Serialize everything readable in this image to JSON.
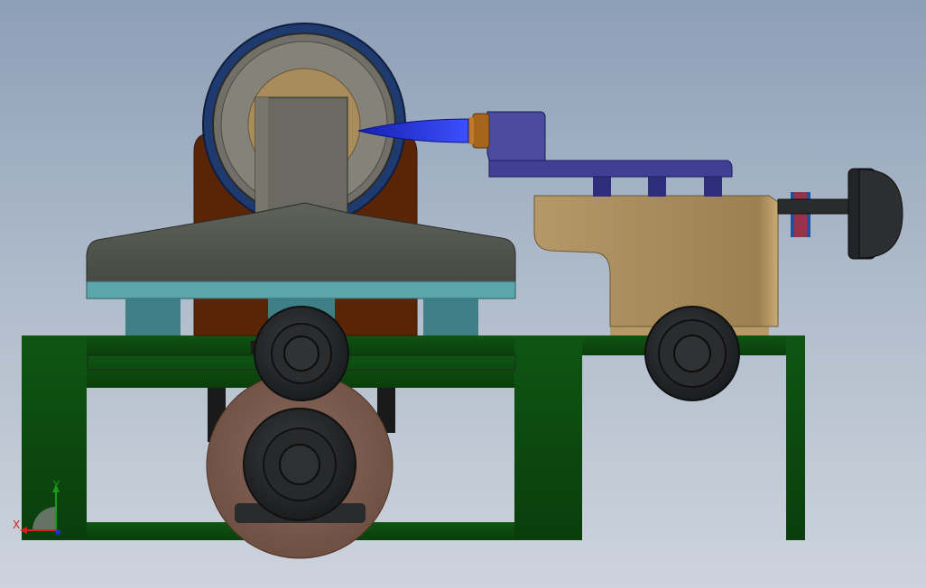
{
  "viewport": {
    "background_top": "#8d9fb7",
    "background_bottom": "#cdd3dc"
  },
  "model": {
    "frame_color": "#0d4a0f",
    "top_assembly_color": "#545650",
    "teal_plate_color": "#5aa6aa",
    "housing_color": "#5a2406",
    "ring_color": "#1f3a6e",
    "tan_block_color": "#a98c5c",
    "purple_arm_color": "#3f3f96",
    "tool_tip_color": "#1f2cc8",
    "wheel_color": "#26282a",
    "disk_color": "#7b5a4c"
  },
  "triad": {
    "x_label": "X",
    "y_label": "Y",
    "x_color": "#d42020",
    "y_color": "#1a9a1a",
    "z_color": "#2030c8"
  }
}
